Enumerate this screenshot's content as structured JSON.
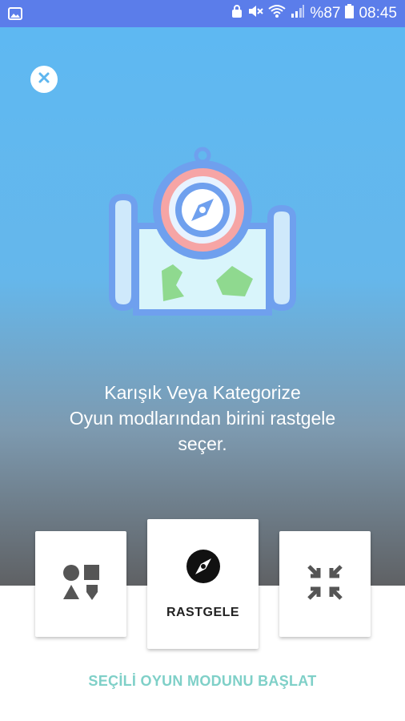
{
  "status_bar": {
    "battery": "%87",
    "time": "08:45",
    "icons": [
      "image-icon",
      "lock-icon",
      "mute-icon",
      "wifi-icon",
      "signal-icon",
      "battery-icon"
    ]
  },
  "description": {
    "line1": "Karışık Veya Kategorize",
    "line2": "Oyun modlarından birini rastgele",
    "line3": "seçer."
  },
  "modes": {
    "left_icon": "shapes-icon",
    "center_icon": "compass-icon",
    "center_label": "RASTGELE",
    "right_icon": "collapse-arrows-icon"
  },
  "start_button": "SEÇİLİ OYUN MODUNU BAŞLAT",
  "colors": {
    "status_bar": "#5b7dea",
    "gradient_top": "#5eb8f2",
    "gradient_bottom": "#5f6164",
    "accent_text": "#7fd0c8"
  }
}
